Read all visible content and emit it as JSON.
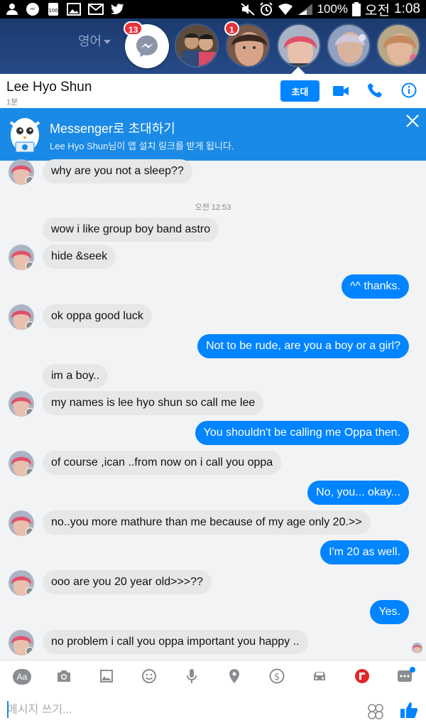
{
  "status_bar": {
    "battery": "100%",
    "ampm": "오전",
    "time": "1:08"
  },
  "heads": {
    "language_label": "영어",
    "messenger_badge": "13",
    "second_badge": "1"
  },
  "conversation": {
    "name": "Lee Hyo Shun",
    "last_active": "1분",
    "invite_label": "초대"
  },
  "banner": {
    "title": "Messenger로 초대하기",
    "subtitle": "Lee Hyo Shun님이 앱 설치 링크를 받게 됩니다."
  },
  "timestamp": "오전 12:53",
  "messages": [
    {
      "dir": "in",
      "text": "why are you not a sleep??"
    },
    {
      "dir": "in",
      "text": "wow i like group boy band astro"
    },
    {
      "dir": "in",
      "text": "hide &seek"
    },
    {
      "dir": "out",
      "text": "^^ thanks."
    },
    {
      "dir": "in",
      "text": "ok oppa good luck"
    },
    {
      "dir": "out",
      "text": "Not to be rude, are you a boy or a girl?"
    },
    {
      "dir": "in",
      "text": "im a boy.."
    },
    {
      "dir": "in",
      "text": "my names is lee hyo shun so call me lee"
    },
    {
      "dir": "out",
      "text": "You shouldn't be calling me Oppa then."
    },
    {
      "dir": "in",
      "text": "of course ,ican ..from now on i call you oppa"
    },
    {
      "dir": "out",
      "text": "No, you... okay..."
    },
    {
      "dir": "in",
      "text": "no..you more mathure than me because  of my age only 20.>>"
    },
    {
      "dir": "out",
      "text": "I'm 20 as well."
    },
    {
      "dir": "in",
      "text": "ooo are you 20 year old>>>??"
    },
    {
      "dir": "out",
      "text": "Yes."
    },
    {
      "dir": "in",
      "text": "no problem i call you oppa important you happy .."
    }
  ],
  "toolbar": {
    "text_icon_label": "Aa"
  },
  "composer": {
    "placeholder": "메시지 쓰기..."
  },
  "colors": {
    "accent": "#0084ff",
    "banner": "#1a8ae6",
    "heads_bar": "#1b3a6f",
    "incoming_bubble": "#e6e7e9"
  }
}
